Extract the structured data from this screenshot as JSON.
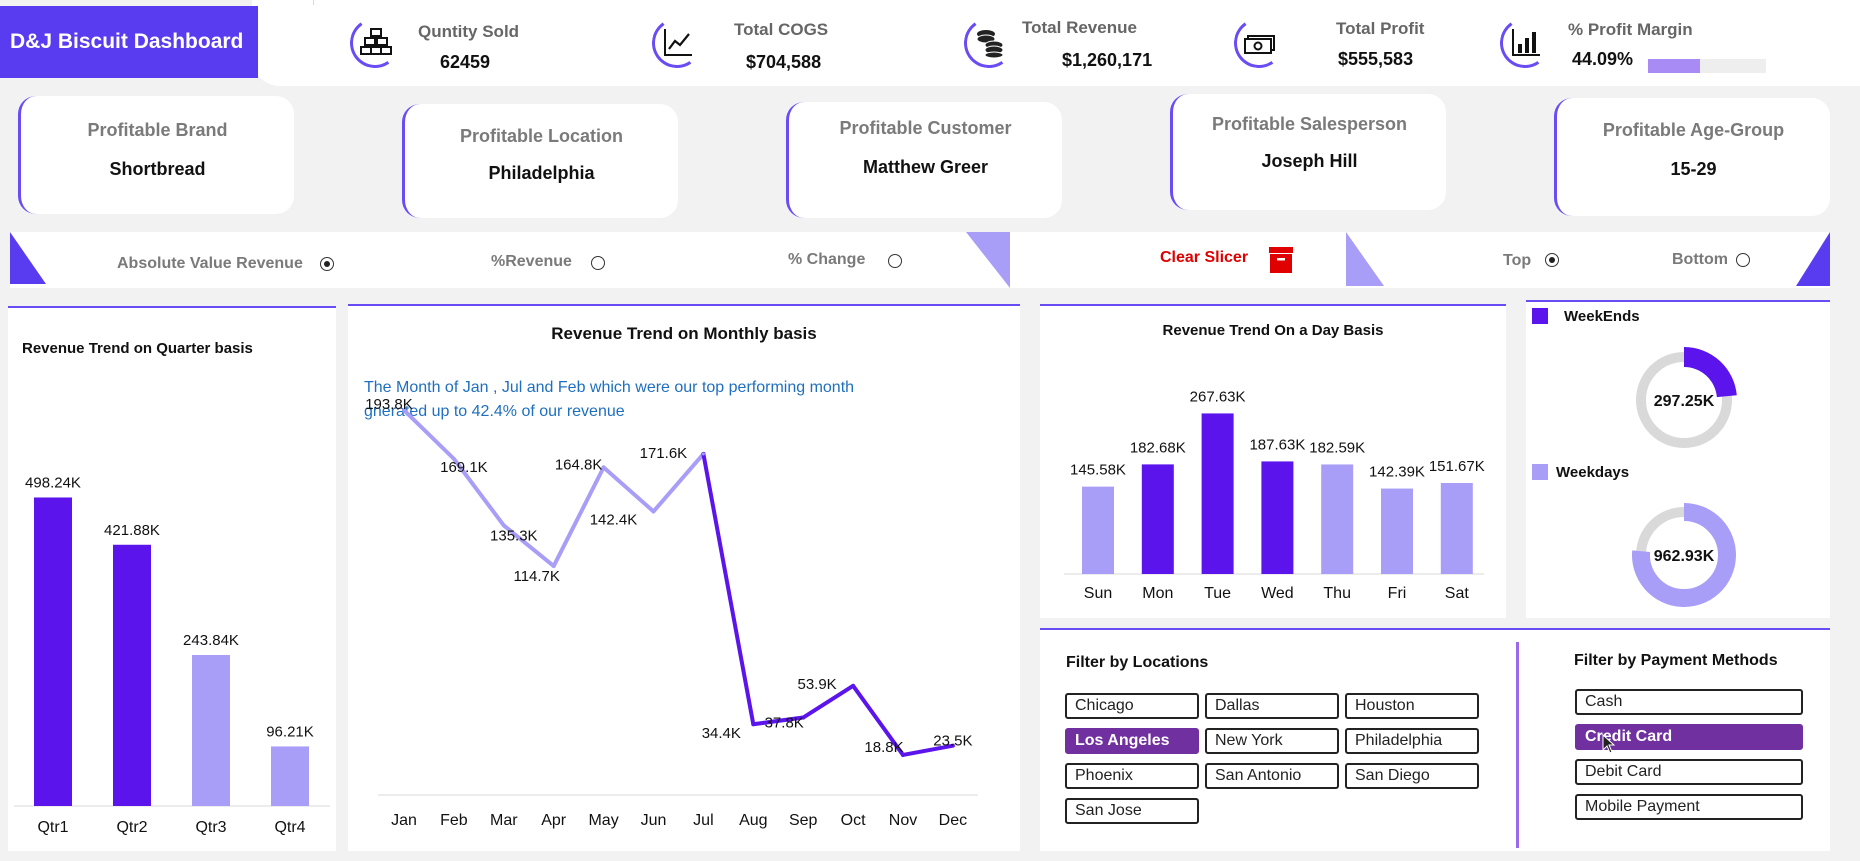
{
  "header": {
    "title": "D&J Biscuit Dashboard"
  },
  "kpis": [
    {
      "label": "Quntity Sold",
      "value": "62459",
      "icon": "bricks-stack-icon"
    },
    {
      "label": "Total COGS",
      "value": "$704,588",
      "icon": "line-trend-icon"
    },
    {
      "label": "Total Revenue",
      "value": "$1,260,171",
      "icon": "coins-icon"
    },
    {
      "label": "Total Profit",
      "value": "$555,583",
      "icon": "banknote-icon"
    },
    {
      "label": "% Profit Margin",
      "value": "44.09%",
      "icon": "bar-chart-icon",
      "progress": 0.4409
    }
  ],
  "profitable": [
    {
      "title": "Profitable Brand",
      "value": "Shortbread"
    },
    {
      "title": "Profitable Location",
      "value": "Philadelphia"
    },
    {
      "title": "Profitable Customer",
      "value": "Matthew Greer"
    },
    {
      "title": "Profitable Salesperson",
      "value": "Joseph Hill"
    },
    {
      "title": "Profitable Age-Group",
      "value": "15-29"
    }
  ],
  "slicer": {
    "abs_label": "Absolute Value Revenue",
    "pct_label": "%Revenue",
    "change_label": "% Change",
    "clear_label": "Clear Slicer",
    "top_label": "Top",
    "bottom_label": "Bottom",
    "selected_measure": "Absolute Value Revenue",
    "selected_rank": "Top"
  },
  "quarter": {
    "title": "Revenue Trend on Quarter basis"
  },
  "monthly": {
    "title": "Revenue Trend on Monthly basis",
    "note_line1": "The Month of  Jan , Jul and Feb which were our top performing month",
    "note_line2": "gnerated up to 42.4% of our revenue"
  },
  "daily": {
    "title": "Revenue Trend On a Day Basis"
  },
  "weekparts": {
    "weekends_label": "WeekEnds",
    "weekdays_label": "Weekdays",
    "weekends_value": "297.25K",
    "weekdays_value": "962.93K"
  },
  "locations": {
    "title": "Filter by Locations",
    "items": [
      "Chicago",
      "Dallas",
      "Houston",
      "Los Angeles",
      "New York",
      "Philadelphia",
      "Phoenix",
      "San Antonio",
      "San Diego",
      "San Jose"
    ],
    "selected": "Los Angeles"
  },
  "payments": {
    "title": "Filter by Payment Methods",
    "items": [
      "Cash",
      "Credit Card",
      "Debit Card",
      "Mobile Payment"
    ],
    "selected": "Credit Card"
  },
  "colors": {
    "accent": "#5a3cf0",
    "dark_purple": "#5b14ec",
    "light_purple": "#a89ef8",
    "selected": "#7030a0",
    "clear_red": "#e00000"
  },
  "chart_data": [
    {
      "type": "bar",
      "title": "Revenue Trend on Quarter basis",
      "categories": [
        "Qtr1",
        "Qtr2",
        "Qtr3",
        "Qtr4"
      ],
      "values": [
        498.24,
        421.88,
        243.84,
        96.21
      ],
      "labels": [
        "498.24K",
        "421.88K",
        "243.84K",
        "96.21K"
      ],
      "highlight": [
        true,
        true,
        false,
        false
      ]
    },
    {
      "type": "line",
      "title": "Revenue Trend on Monthly basis",
      "categories": [
        "Jan",
        "Feb",
        "Mar",
        "Apr",
        "May",
        "Jun",
        "Jul",
        "Aug",
        "Sep",
        "Oct",
        "Nov",
        "Dec"
      ],
      "values": [
        193.8,
        169.1,
        135.3,
        114.7,
        164.8,
        142.4,
        171.6,
        34.4,
        37.8,
        53.9,
        18.8,
        23.5
      ],
      "labels": [
        "193.8K",
        "169.1K",
        "135.3K",
        "114.7K",
        "164.8K",
        "142.4K",
        "171.6K",
        "34.4K",
        "37.8K",
        "53.9K",
        "18.8K",
        "23.5K"
      ]
    },
    {
      "type": "bar",
      "title": "Revenue Trend On a Day Basis",
      "categories": [
        "Sun",
        "Mon",
        "Tue",
        "Wed",
        "Thu",
        "Fri",
        "Sat"
      ],
      "values": [
        145.58,
        182.68,
        267.63,
        187.63,
        182.59,
        142.39,
        151.67
      ],
      "labels": [
        "145.58K",
        "182.68K",
        "267.63K",
        "187.63K",
        "182.59K",
        "142.39K",
        "151.67K"
      ],
      "highlight": [
        false,
        true,
        true,
        true,
        false,
        false,
        false
      ]
    },
    {
      "type": "pie",
      "title": "",
      "series": [
        {
          "name": "WeekEnds",
          "value": 297.25,
          "label": "297.25K"
        },
        {
          "name": "Weekdays",
          "value": 962.93,
          "label": "962.93K"
        }
      ]
    }
  ]
}
